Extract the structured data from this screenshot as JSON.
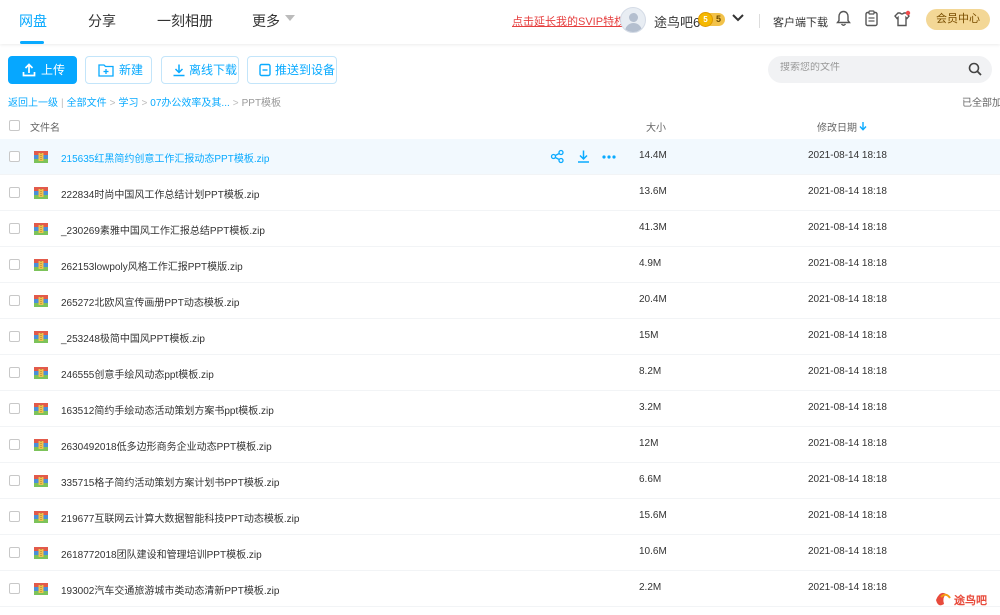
{
  "nav": {
    "tabs": [
      {
        "label": "网盘"
      },
      {
        "label": "分享"
      },
      {
        "label": "一刻相册"
      },
      {
        "label": "更多"
      }
    ],
    "svip_link": "点击延长我的SVIP特权",
    "username": "途鸟吧6",
    "badge_level": "5",
    "badge_text": "5",
    "client_download": "客户端下载",
    "vip_center": "会员中心"
  },
  "toolbar": {
    "upload": "上传",
    "new_folder": "新建",
    "offline_download": "离线下载",
    "push_device": "推送到设备",
    "search_placeholder": "搜索您的文件"
  },
  "breadcrumb": {
    "back": "返回上一级",
    "all_files": "全部文件",
    "level1": "学习",
    "level2": "07办公效率及其...",
    "current": "PPT模板",
    "loaded_status": "已全部加"
  },
  "table": {
    "col_name": "文件名",
    "col_size": "大小",
    "col_date": "修改日期",
    "rows": [
      {
        "name": "215635红黑简约创意工作汇报动态PPT模板.zip",
        "size": "14.4M",
        "date": "2021-08-14 18:18"
      },
      {
        "name": "222834时尚中国风工作总结计划PPT模板.zip",
        "size": "13.6M",
        "date": "2021-08-14 18:18"
      },
      {
        "name": "_230269素雅中国风工作汇报总结PPT模板.zip",
        "size": "41.3M",
        "date": "2021-08-14 18:18"
      },
      {
        "name": "262153lowpoly风格工作汇报PPT模版.zip",
        "size": "4.9M",
        "date": "2021-08-14 18:18"
      },
      {
        "name": "265272北欧风宣传画册PPT动态模板.zip",
        "size": "20.4M",
        "date": "2021-08-14 18:18"
      },
      {
        "name": "_253248极简中国风PPT模板.zip",
        "size": "15M",
        "date": "2021-08-14 18:18"
      },
      {
        "name": "246555创意手绘风动态ppt模板.zip",
        "size": "8.2M",
        "date": "2021-08-14 18:18"
      },
      {
        "name": "163512简约手绘动态活动策划方案书ppt模板.zip",
        "size": "3.2M",
        "date": "2021-08-14 18:18"
      },
      {
        "name": "2630492018低多边形商务企业动态PPT模板.zip",
        "size": "12M",
        "date": "2021-08-14 18:18"
      },
      {
        "name": "335715格子简约活动策划方案计划书PPT模板.zip",
        "size": "6.6M",
        "date": "2021-08-14 18:18"
      },
      {
        "name": "219677互联网云计算大数据智能科技PPT动态模板.zip",
        "size": "15.6M",
        "date": "2021-08-14 18:18"
      },
      {
        "name": "2618772018团队建设和管理培训PPT模板.zip",
        "size": "10.6M",
        "date": "2021-08-14 18:18"
      },
      {
        "name": "193002汽车交通旅游城市类动态清新PPT模板.zip",
        "size": "2.2M",
        "date": "2021-08-14 18:18"
      }
    ]
  },
  "watermark": {
    "text": "途鸟吧"
  },
  "colors": {
    "accent": "#09AAFF",
    "svip_red": "#e63f3f",
    "vip_gold": "#f3d796"
  }
}
